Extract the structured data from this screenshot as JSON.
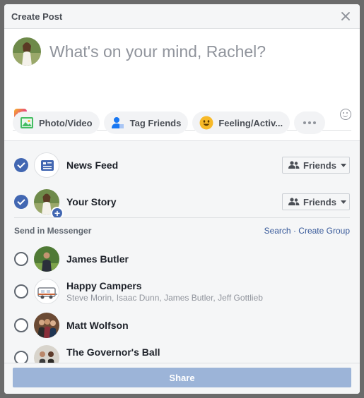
{
  "dialog": {
    "title": "Create Post"
  },
  "composer": {
    "placeholder": "What's on your mind, Rachel?"
  },
  "actions": {
    "photo_video": "Photo/Video",
    "tag_friends": "Tag Friends",
    "feeling": "Feeling/Activ..."
  },
  "audience": {
    "news_feed": {
      "label": "News Feed",
      "privacy": "Friends",
      "checked": true
    },
    "your_story": {
      "label": "Your Story",
      "privacy": "Friends",
      "checked": true
    }
  },
  "messenger": {
    "title": "Send in Messenger",
    "search": "Search",
    "separator": "·",
    "create_group": "Create Group",
    "contacts": [
      {
        "name": "James Butler",
        "subtitle": ""
      },
      {
        "name": "Happy Campers",
        "subtitle": "Steve Morin, Isaac Dunn, James Butler, Jeff Gottlieb"
      },
      {
        "name": "Matt Wolfson",
        "subtitle": ""
      },
      {
        "name": "The Governor's Ball",
        "subtitle": ""
      }
    ]
  },
  "footer": {
    "share": "Share"
  },
  "colors": {
    "accent": "#4267b2",
    "share_disabled": "#9cb4d8",
    "link": "#365899"
  },
  "icons": [
    "close-icon",
    "aa-icon",
    "emoji-icon",
    "photo-icon",
    "tag-icon",
    "feeling-icon",
    "more-icon",
    "news-feed-icon",
    "friends-icon",
    "plus-icon"
  ]
}
